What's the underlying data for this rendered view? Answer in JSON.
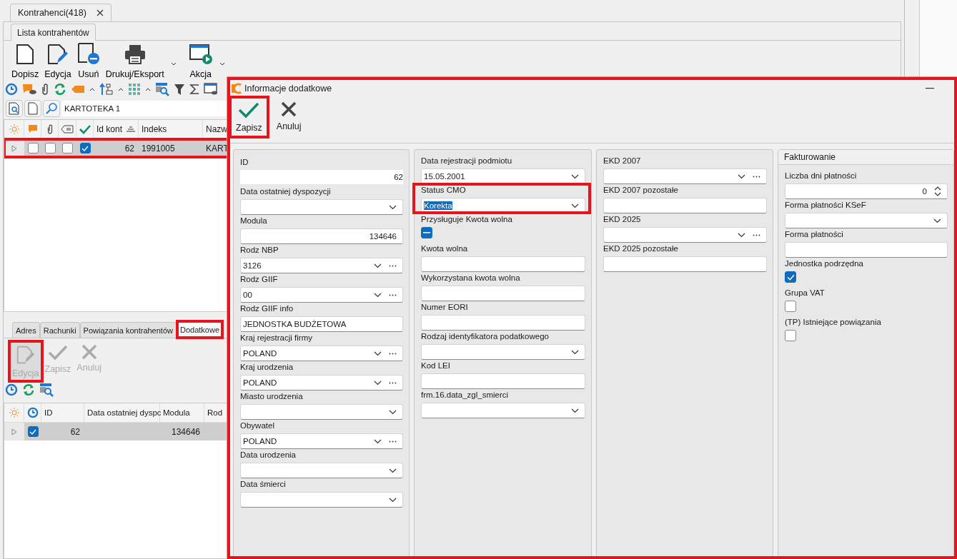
{
  "tabs": [
    {
      "label": "Kontrahenci(418)",
      "selected": true
    }
  ],
  "subtabs": [
    {
      "label": "Lista kontrahentów",
      "selected": true
    }
  ],
  "toolbar": [
    {
      "label": "Dopisz",
      "kind": "new",
      "dropdown": false
    },
    {
      "label": "Edycja",
      "kind": "edit",
      "dropdown": false
    },
    {
      "label": "Usuń",
      "kind": "delete",
      "dropdown": false
    },
    {
      "label": "Drukuj/Eksport",
      "kind": "print",
      "dropdown": true
    },
    {
      "label": "Akcja",
      "kind": "action",
      "dropdown": true
    }
  ],
  "filter": {
    "value": "KARTOTEKA 1"
  },
  "grid": {
    "columns": [
      "Id kont",
      "Indeks",
      "Nazw"
    ],
    "rows": [
      {
        "flags": [
          false,
          false,
          false,
          true
        ],
        "id": "62",
        "index": "1991005",
        "name": "KART",
        "selected": true,
        "highlighted": true
      }
    ]
  },
  "detail_tabs": [
    {
      "label": "Adres",
      "selected": false,
      "highlighted": false
    },
    {
      "label": "Rachunki",
      "selected": false,
      "highlighted": false
    },
    {
      "label": "Powiązania kontrahentów",
      "selected": false,
      "highlighted": false
    },
    {
      "label": "Dodatkowe",
      "selected": true,
      "highlighted": true
    }
  ],
  "detail_toolbar": [
    {
      "label": "Edycja",
      "kind": "edit",
      "disabled": true,
      "highlighted": true
    },
    {
      "label": "Zapisz",
      "kind": "save",
      "disabled": true,
      "highlighted": false
    },
    {
      "label": "Anuluj",
      "kind": "cancel",
      "disabled": true,
      "highlighted": false
    }
  ],
  "detail_grid": {
    "columns": [
      "ID",
      "Data ostatniej dyspc",
      "Modula",
      "Rod"
    ],
    "rows": [
      {
        "checked": true,
        "id": "62",
        "modula": "134646",
        "selected": true
      }
    ]
  },
  "dialog": {
    "title": "Informacje dodatkowe",
    "highlighted": true,
    "toolbar": [
      {
        "label": "Zapisz",
        "kind": "save",
        "disabled": false,
        "highlighted": true
      },
      {
        "label": "Anuluj",
        "kind": "cancel",
        "disabled": false,
        "highlighted": false
      }
    ],
    "columns": [
      {
        "fields": [
          {
            "label": "ID",
            "kind": "readonly",
            "value": "62"
          },
          {
            "label": "Data ostatniej dyspozycji",
            "kind": "combo"
          },
          {
            "label": "Modula",
            "kind": "number",
            "value": "134646"
          },
          {
            "label": "Rodz NBP",
            "kind": "combo_more",
            "value": "3126"
          },
          {
            "label": "Rodz GIIF",
            "kind": "combo_more",
            "value": "00"
          },
          {
            "label": "Rodz GIIF info",
            "kind": "text",
            "value": "JEDNOSTKA BUDŻETOWA"
          },
          {
            "label": "Kraj rejestracji firmy",
            "kind": "combo_more",
            "value": "POLAND"
          },
          {
            "label": "Kraj urodzenia",
            "kind": "combo_more",
            "value": "POLAND"
          },
          {
            "label": "Miasto urodzenia",
            "kind": "combo"
          },
          {
            "label": "Obywatel",
            "kind": "combo_more",
            "value": "POLAND"
          },
          {
            "label": "Data urodzenia",
            "kind": "combo"
          },
          {
            "label": "Data śmierci",
            "kind": "combo"
          }
        ]
      },
      {
        "fields": [
          {
            "label": "Data rejestracji podmiotu",
            "kind": "combo",
            "value": "15.05.2001"
          },
          {
            "label": "Status CMO",
            "kind": "combo",
            "value": "Korekta",
            "focused": true,
            "text_selected": true,
            "highlighted": true
          },
          {
            "label": "Przysługuje Kwota wolna",
            "kind": "checkbox",
            "indeterminate": true
          },
          {
            "label": "Kwota wolna",
            "kind": "text"
          },
          {
            "label": "Wykorzystana kwota wolna",
            "kind": "text"
          },
          {
            "label": "Numer EORI",
            "kind": "text"
          },
          {
            "label": "Rodzaj identyfikatora podatkowego",
            "kind": "combo"
          },
          {
            "label": "Kod LEI",
            "kind": "text"
          },
          {
            "label": "frm.16.data_zgl_smierci",
            "kind": "combo"
          }
        ]
      },
      {
        "fields": [
          {
            "label": "EKD 2007",
            "kind": "combo_more"
          },
          {
            "label": "EKD 2007 pozostałe",
            "kind": "text"
          },
          {
            "label": "EKD 2025",
            "kind": "combo_more"
          },
          {
            "label": "EKD 2025 pozostałe",
            "kind": "text"
          }
        ]
      },
      {
        "title": "Fakturowanie",
        "fields": [
          {
            "label": "Liczba dni płatności",
            "kind": "spin",
            "value": "0"
          },
          {
            "label": "Forma płatności KSeF",
            "kind": "combo"
          },
          {
            "label": "Forma płatności",
            "kind": "text"
          },
          {
            "label": "Jednostka podrzędna",
            "kind": "checkbox",
            "checked": true
          },
          {
            "label": "Grupa VAT",
            "kind": "checkbox",
            "checked": false
          },
          {
            "label": "(TP) Istniejące powiązania",
            "kind": "checkbox",
            "checked": false
          }
        ]
      }
    ]
  }
}
